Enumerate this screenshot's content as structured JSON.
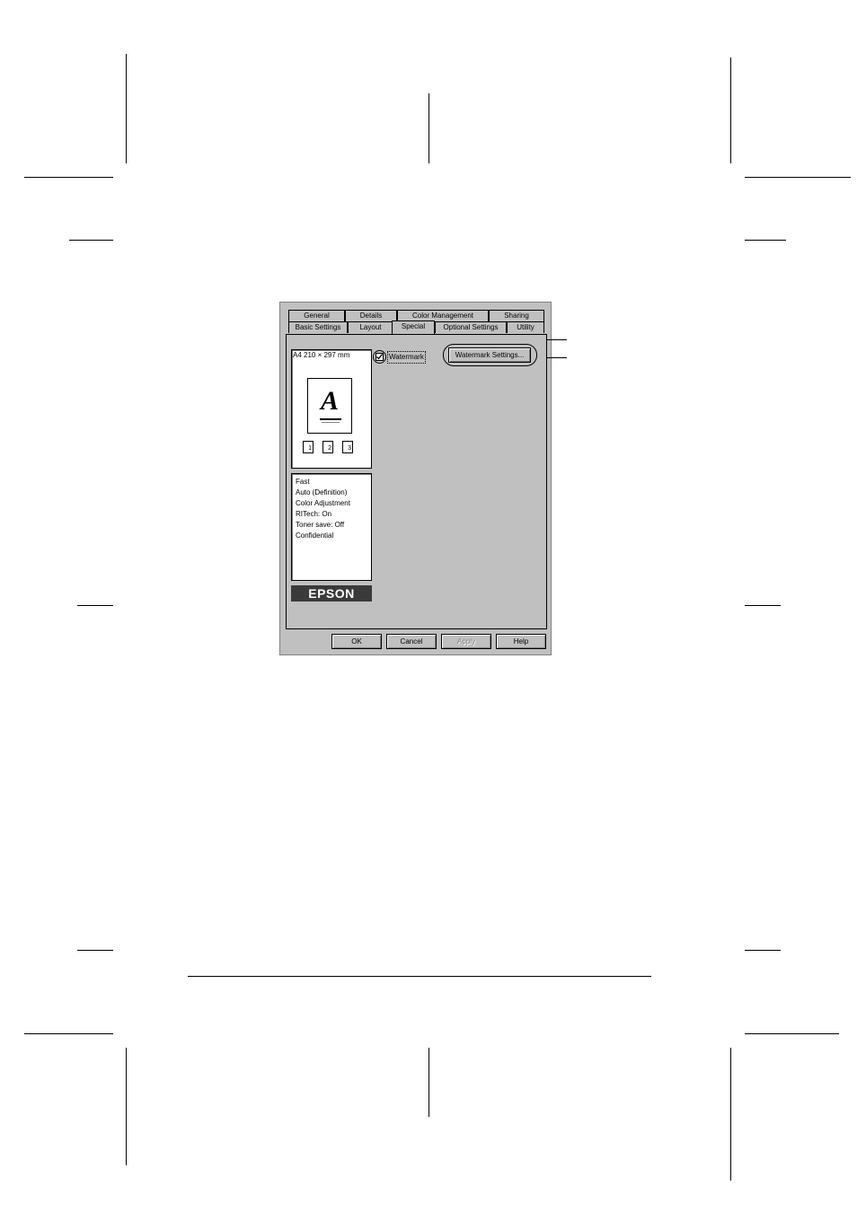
{
  "dialog": {
    "tabs_row1": [
      "General",
      "Details",
      "Color Management",
      "Sharing"
    ],
    "tabs_row2": [
      "Basic Settings",
      "Layout",
      "Special",
      "Optional Settings",
      "Utility"
    ],
    "active_tab": "Special",
    "preview": {
      "paper_label": "A4 210 × 297 mm",
      "letter": "A",
      "page_numbers": [
        "1",
        "2",
        "3"
      ]
    },
    "summary_lines": [
      "Fast",
      "Auto (Definition)",
      "Color Adjustment",
      "RITech: On",
      "Toner save: Off",
      "Confidential"
    ],
    "brand": "EPSON",
    "watermark_checkbox_label": "Watermark",
    "watermark_checked": true,
    "watermark_settings_button": "Watermark Settings...",
    "buttons": {
      "ok": "OK",
      "cancel": "Cancel",
      "apply": "Apply",
      "help": "Help"
    }
  }
}
